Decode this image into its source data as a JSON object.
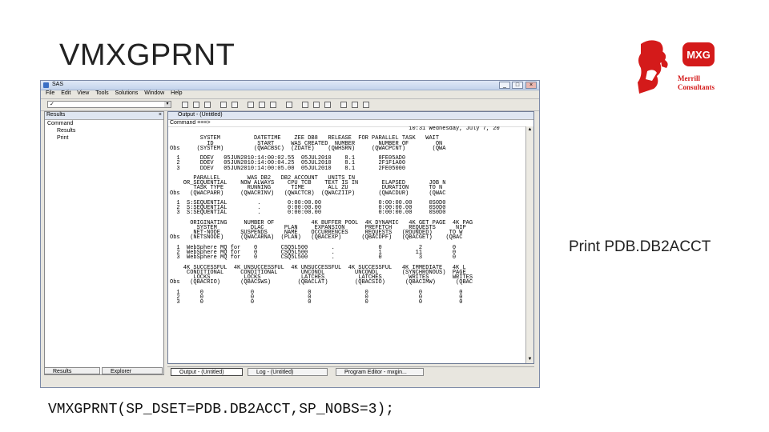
{
  "slide": {
    "title": "VMXGPRNT",
    "caption": "Print PDB.DB2ACCT",
    "code": "VMXGPRNT(SP_DSET=PDB.DB2ACCT,SP_NOBS=3);"
  },
  "logo": {
    "text_top": "MXG",
    "text_name1": "Merrill",
    "text_name2": "Consultants",
    "color": "#d41a1a"
  },
  "sas": {
    "title": "SAS",
    "menu": [
      "File",
      "Edit",
      "View",
      "Tools",
      "Solutions",
      "Window",
      "Help"
    ],
    "explorer": {
      "header": "Results",
      "root": "Command",
      "items": [
        "Results",
        "Print"
      ]
    },
    "bottom_tabs": [
      "Results",
      "Explorer"
    ],
    "output": {
      "header": "Output - (Untitled)",
      "command": "Command ===>",
      "report": "                                                                       10:31 Wednesday, July 7, 20\n\n         SYSTEM          DATETIME    ZEE DB8   RELEASE  FOR PARALLEL TASK   WAIT\n           ID             START     WAS CREATED  NUMBER       NUMBER OF        ON\nObs     (SYSTEM)         (QWACBSC)  (ZDATE)    (QWHSRN)     (QWACPCNT)        (QWA\n\n  1      DDEV   05JUN2010:14:00:02.55  05JUL2010    8.1       8FE05AD0\n  2      DDEV   05JUN2010:14:00:04.25  05JUL2010    8.1       2F1F1A00\n  3      DDEV   05JUN2010:14:00:05.00  05JUL2010    8.1       2FE05000\n\n       PARALLEL        WAS DB2   DB2 ACCOUNT   UNITS IN\n    OR_SEQUENTIAL    NOW ALWAYS    CPU TCB    TEXT IS IN       ELAPSED       JOB N\n       TASK TYPE       RUNNING      TIME       ALL ZU          DURATION      TO N\nObs   (QWACPARR)     (QWACRINV)   (QWACTCB)  (QWACZIIP)       (QWACDUR)      (QWAC\n\n  1  S:SEQUENTIAL         .        0:00:00.00                 0:00:00.00     0S0D0\n  2  S:SEQUENTIAL         .        0:00:00.00                 0:00:00.00     0S0D0\n  3  S:SEQUENTIAL         .        0:00:00.00                 0:00:00.00     0S0D0\n\n      ORIGINATING     NUMBER OF           4K BUFFER POOL  4K DYNAMIC   4K GET PAGE  4K PAG\n        SYSTEM          DLAC      PLAN     EXPANSION      PREFETCH     REQUESTS      NIP\n       NET-NODE      SUSPENDS     NAME    OCCURRENCES     REQUESTS   (ROUNDED)     TO W\nObs   (NETSNODE)     (QWACARNA)  (PLAN)   (QBACEXP)      (QBACDPF)   (QBACGET)    (QBAC\n\n  1  WebSphere MQ for    0       CSQ5L500       .             0           2         0\n  2  WebSphere MQ for    0       CSQ5L500       .             1          11         0\n  3  WebSphere MQ for    0       CSQ5L500       .             0           3         0\n\n    4K SUCCESSFUL  4K UNSUCCESSFUL  4K UNSUCCESSFUL  4K SUCCESSFUL   4K IMMEDIATE   4K L\n     CONDITIONAL     CONDITIONAL       UNCONDL         UNCONDL       (SYNCHRONOUS)  PAGE\n       LOCKS          LOCKS            LATCHES          LATCHES        WRITES       WRITES\nObs   (QBACRIO)      (QBACSWS)        (QBACLAT)        (QBACSIO)      (QBACIMW)      (QBAC\n\n  1      0              0                0                0               0           0\n  2      0              0                0                0               0           0\n  3      0              0                0                0               0           0"
    },
    "taskbar": [
      "Output - (Untitled)",
      "Log - (Untitled)",
      "Program Editor - mxgin..."
    ]
  }
}
